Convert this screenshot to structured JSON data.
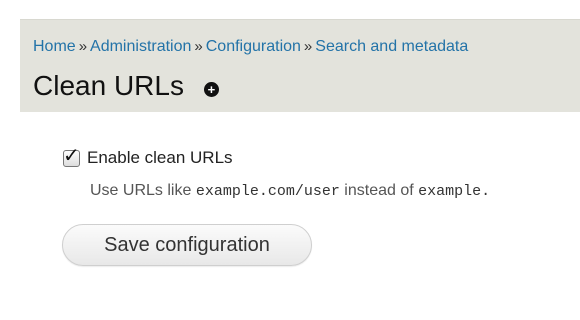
{
  "breadcrumb": {
    "items": [
      {
        "label": "Home"
      },
      {
        "label": "Administration"
      },
      {
        "label": "Configuration"
      },
      {
        "label": "Search and metadata"
      }
    ],
    "separator": "»"
  },
  "page": {
    "title": "Clean URLs",
    "shortcut_icon": "add-shortcut-icon"
  },
  "form": {
    "checkbox": {
      "label": "Enable clean URLs",
      "checked": true
    },
    "description": {
      "prefix": "Use URLs like ",
      "example_clean": "example.com/user",
      "middle": " instead of ",
      "example_dirty": "example."
    },
    "save_button_label": "Save configuration"
  },
  "colors": {
    "header_background": "#e3e3dc",
    "link": "#2373a8"
  }
}
